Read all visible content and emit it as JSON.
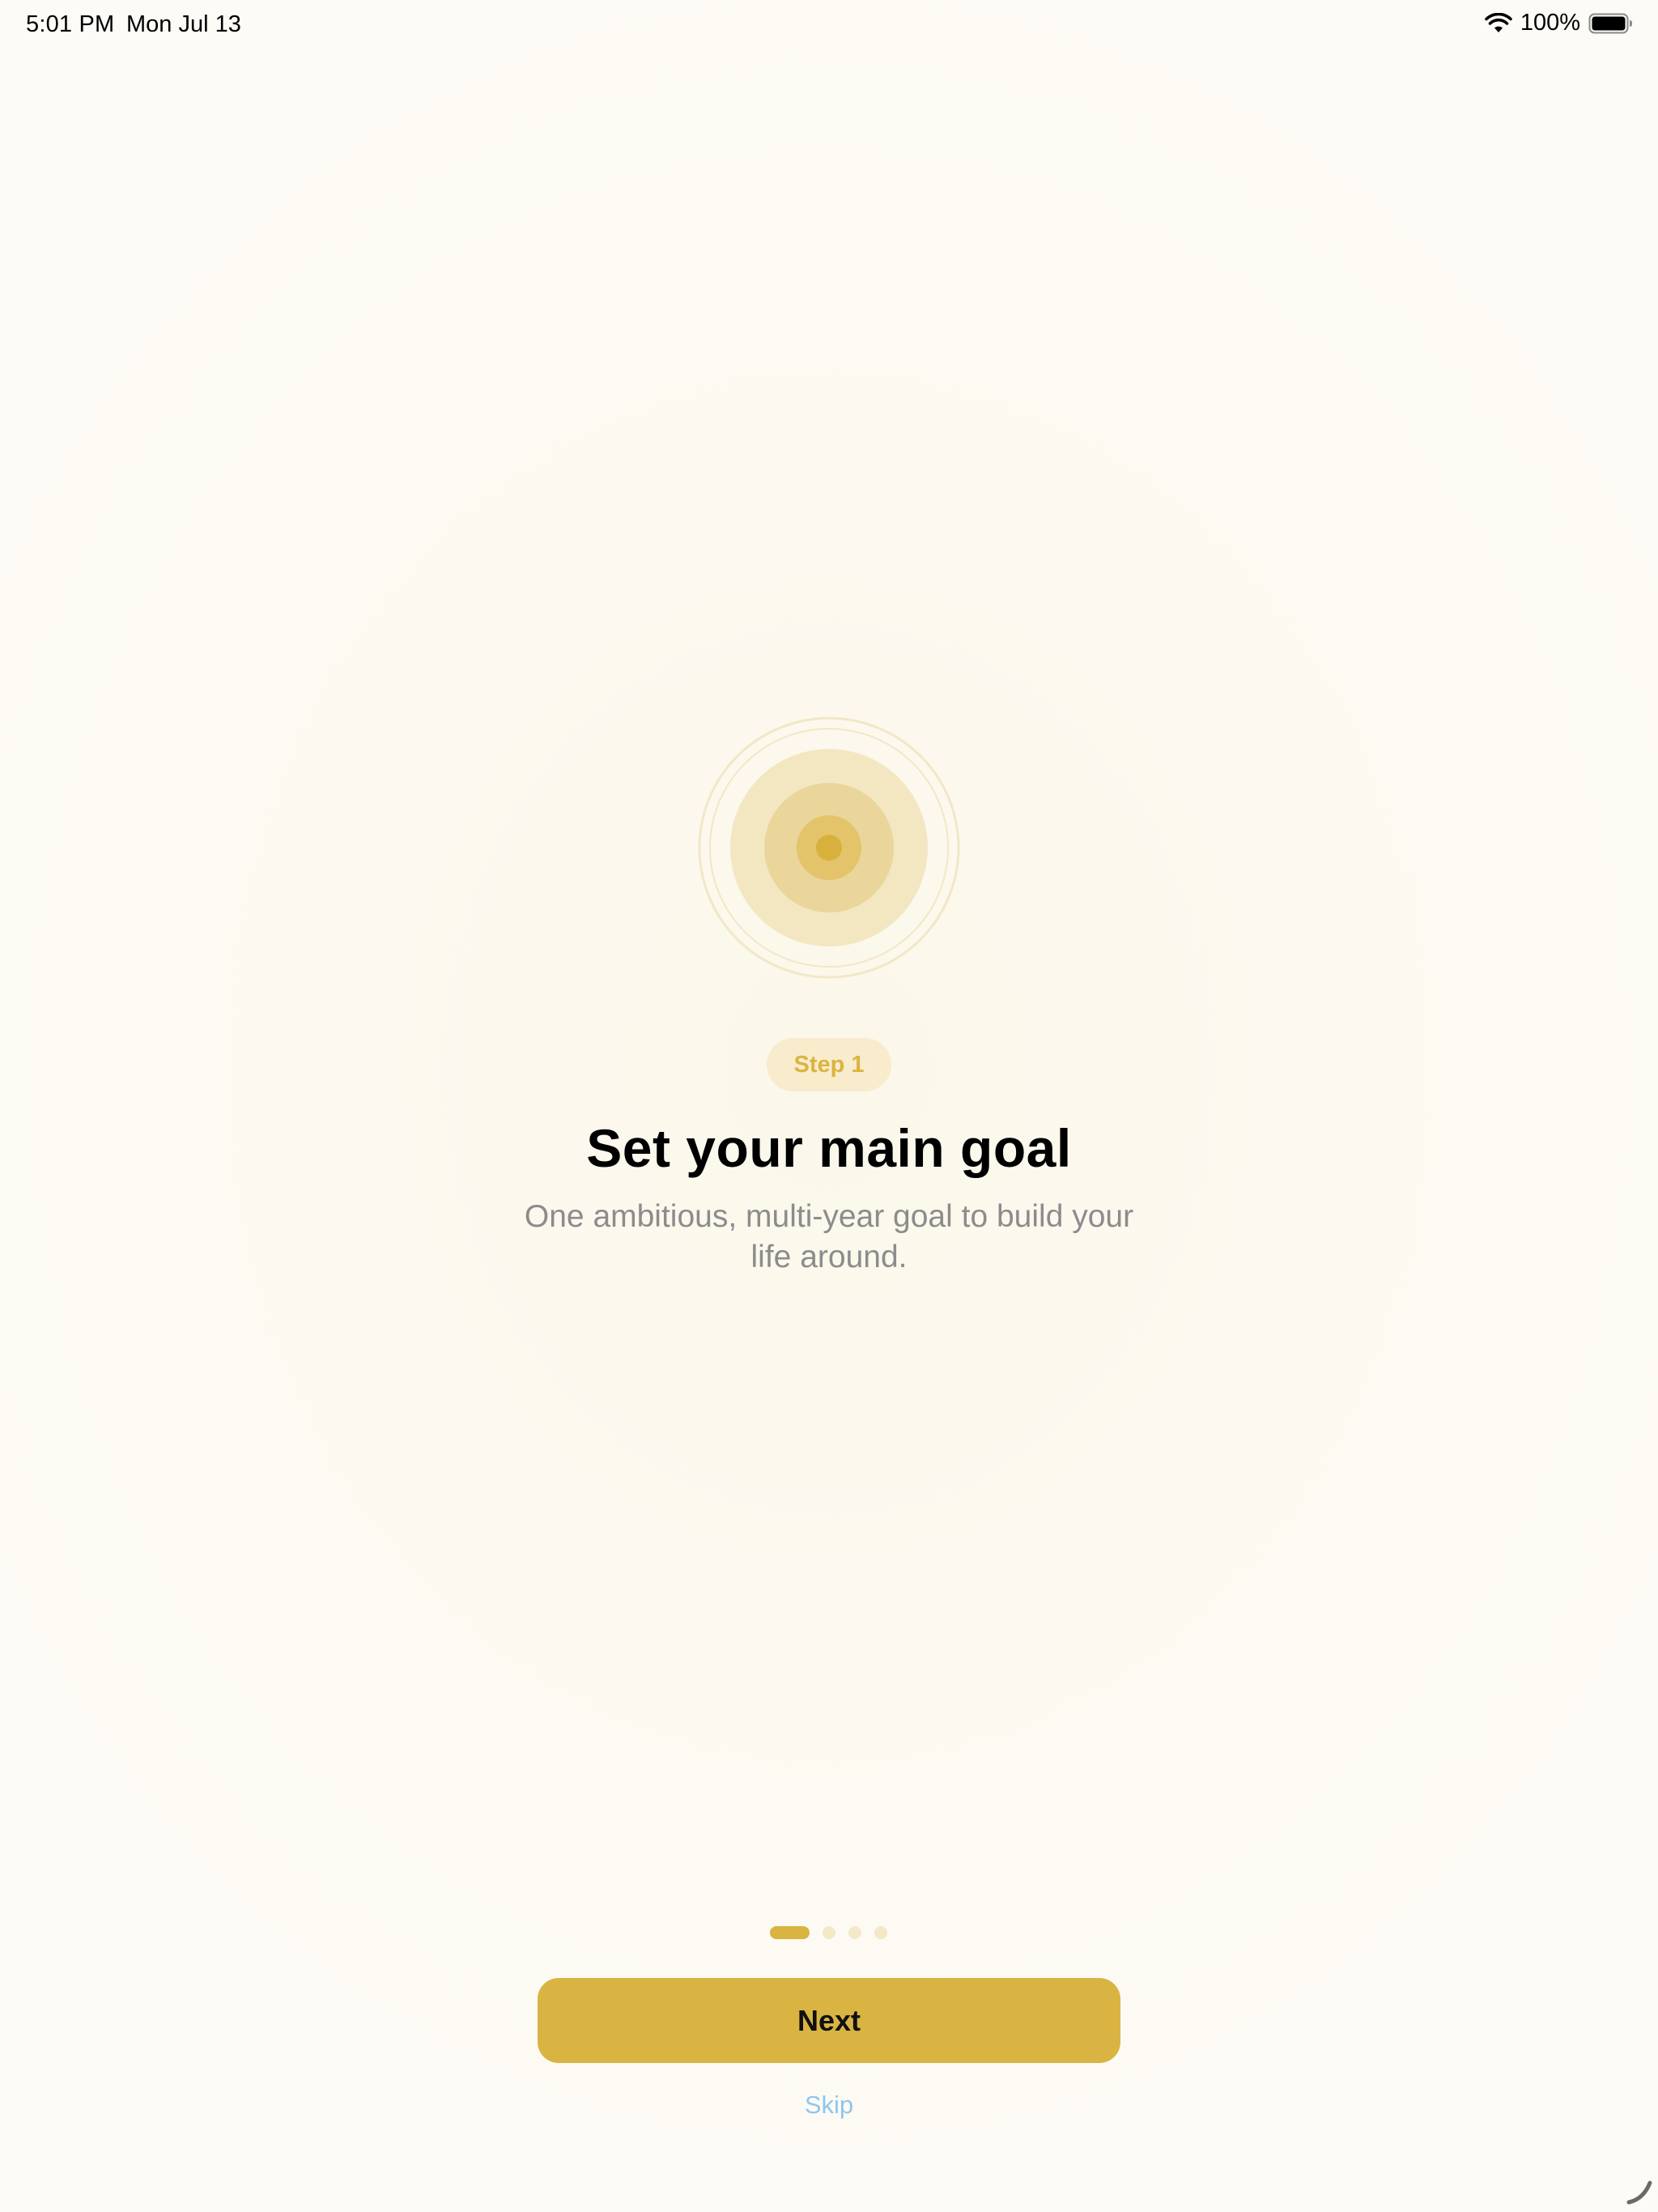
{
  "status_bar": {
    "time": "5:01 PM",
    "date": "Mon Jul 13",
    "battery_percent": "100%",
    "icons": [
      "wifi-icon",
      "battery-icon"
    ]
  },
  "onboarding": {
    "graphic": "target-icon",
    "step_label": "Step 1",
    "title": "Set your main goal",
    "subtitle": "One ambitious, multi-year goal to build your life around.",
    "page_count": 4,
    "current_page": 1
  },
  "actions": {
    "next_label": "Next",
    "skip_label": "Skip"
  },
  "colors": {
    "accent": "#d9b442",
    "accent_light": "#f8eccd",
    "link": "#8ec6ee",
    "subtitle": "#8c8c8c",
    "background": "#fdfbf5"
  }
}
